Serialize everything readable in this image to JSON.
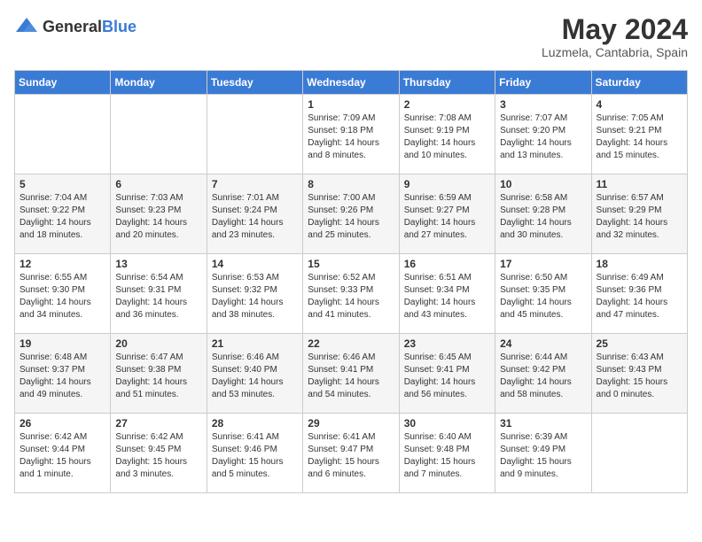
{
  "header": {
    "logo_general": "General",
    "logo_blue": "Blue",
    "month_title": "May 2024",
    "location": "Luzmela, Cantabria, Spain"
  },
  "weekdays": [
    "Sunday",
    "Monday",
    "Tuesday",
    "Wednesday",
    "Thursday",
    "Friday",
    "Saturday"
  ],
  "weeks": [
    [
      {
        "day": "",
        "sunrise": "",
        "sunset": "",
        "daylight": ""
      },
      {
        "day": "",
        "sunrise": "",
        "sunset": "",
        "daylight": ""
      },
      {
        "day": "",
        "sunrise": "",
        "sunset": "",
        "daylight": ""
      },
      {
        "day": "1",
        "sunrise": "Sunrise: 7:09 AM",
        "sunset": "Sunset: 9:18 PM",
        "daylight": "Daylight: 14 hours and 8 minutes."
      },
      {
        "day": "2",
        "sunrise": "Sunrise: 7:08 AM",
        "sunset": "Sunset: 9:19 PM",
        "daylight": "Daylight: 14 hours and 10 minutes."
      },
      {
        "day": "3",
        "sunrise": "Sunrise: 7:07 AM",
        "sunset": "Sunset: 9:20 PM",
        "daylight": "Daylight: 14 hours and 13 minutes."
      },
      {
        "day": "4",
        "sunrise": "Sunrise: 7:05 AM",
        "sunset": "Sunset: 9:21 PM",
        "daylight": "Daylight: 14 hours and 15 minutes."
      }
    ],
    [
      {
        "day": "5",
        "sunrise": "Sunrise: 7:04 AM",
        "sunset": "Sunset: 9:22 PM",
        "daylight": "Daylight: 14 hours and 18 minutes."
      },
      {
        "day": "6",
        "sunrise": "Sunrise: 7:03 AM",
        "sunset": "Sunset: 9:23 PM",
        "daylight": "Daylight: 14 hours and 20 minutes."
      },
      {
        "day": "7",
        "sunrise": "Sunrise: 7:01 AM",
        "sunset": "Sunset: 9:24 PM",
        "daylight": "Daylight: 14 hours and 23 minutes."
      },
      {
        "day": "8",
        "sunrise": "Sunrise: 7:00 AM",
        "sunset": "Sunset: 9:26 PM",
        "daylight": "Daylight: 14 hours and 25 minutes."
      },
      {
        "day": "9",
        "sunrise": "Sunrise: 6:59 AM",
        "sunset": "Sunset: 9:27 PM",
        "daylight": "Daylight: 14 hours and 27 minutes."
      },
      {
        "day": "10",
        "sunrise": "Sunrise: 6:58 AM",
        "sunset": "Sunset: 9:28 PM",
        "daylight": "Daylight: 14 hours and 30 minutes."
      },
      {
        "day": "11",
        "sunrise": "Sunrise: 6:57 AM",
        "sunset": "Sunset: 9:29 PM",
        "daylight": "Daylight: 14 hours and 32 minutes."
      }
    ],
    [
      {
        "day": "12",
        "sunrise": "Sunrise: 6:55 AM",
        "sunset": "Sunset: 9:30 PM",
        "daylight": "Daylight: 14 hours and 34 minutes."
      },
      {
        "day": "13",
        "sunrise": "Sunrise: 6:54 AM",
        "sunset": "Sunset: 9:31 PM",
        "daylight": "Daylight: 14 hours and 36 minutes."
      },
      {
        "day": "14",
        "sunrise": "Sunrise: 6:53 AM",
        "sunset": "Sunset: 9:32 PM",
        "daylight": "Daylight: 14 hours and 38 minutes."
      },
      {
        "day": "15",
        "sunrise": "Sunrise: 6:52 AM",
        "sunset": "Sunset: 9:33 PM",
        "daylight": "Daylight: 14 hours and 41 minutes."
      },
      {
        "day": "16",
        "sunrise": "Sunrise: 6:51 AM",
        "sunset": "Sunset: 9:34 PM",
        "daylight": "Daylight: 14 hours and 43 minutes."
      },
      {
        "day": "17",
        "sunrise": "Sunrise: 6:50 AM",
        "sunset": "Sunset: 9:35 PM",
        "daylight": "Daylight: 14 hours and 45 minutes."
      },
      {
        "day": "18",
        "sunrise": "Sunrise: 6:49 AM",
        "sunset": "Sunset: 9:36 PM",
        "daylight": "Daylight: 14 hours and 47 minutes."
      }
    ],
    [
      {
        "day": "19",
        "sunrise": "Sunrise: 6:48 AM",
        "sunset": "Sunset: 9:37 PM",
        "daylight": "Daylight: 14 hours and 49 minutes."
      },
      {
        "day": "20",
        "sunrise": "Sunrise: 6:47 AM",
        "sunset": "Sunset: 9:38 PM",
        "daylight": "Daylight: 14 hours and 51 minutes."
      },
      {
        "day": "21",
        "sunrise": "Sunrise: 6:46 AM",
        "sunset": "Sunset: 9:40 PM",
        "daylight": "Daylight: 14 hours and 53 minutes."
      },
      {
        "day": "22",
        "sunrise": "Sunrise: 6:46 AM",
        "sunset": "Sunset: 9:41 PM",
        "daylight": "Daylight: 14 hours and 54 minutes."
      },
      {
        "day": "23",
        "sunrise": "Sunrise: 6:45 AM",
        "sunset": "Sunset: 9:41 PM",
        "daylight": "Daylight: 14 hours and 56 minutes."
      },
      {
        "day": "24",
        "sunrise": "Sunrise: 6:44 AM",
        "sunset": "Sunset: 9:42 PM",
        "daylight": "Daylight: 14 hours and 58 minutes."
      },
      {
        "day": "25",
        "sunrise": "Sunrise: 6:43 AM",
        "sunset": "Sunset: 9:43 PM",
        "daylight": "Daylight: 15 hours and 0 minutes."
      }
    ],
    [
      {
        "day": "26",
        "sunrise": "Sunrise: 6:42 AM",
        "sunset": "Sunset: 9:44 PM",
        "daylight": "Daylight: 15 hours and 1 minute."
      },
      {
        "day": "27",
        "sunrise": "Sunrise: 6:42 AM",
        "sunset": "Sunset: 9:45 PM",
        "daylight": "Daylight: 15 hours and 3 minutes."
      },
      {
        "day": "28",
        "sunrise": "Sunrise: 6:41 AM",
        "sunset": "Sunset: 9:46 PM",
        "daylight": "Daylight: 15 hours and 5 minutes."
      },
      {
        "day": "29",
        "sunrise": "Sunrise: 6:41 AM",
        "sunset": "Sunset: 9:47 PM",
        "daylight": "Daylight: 15 hours and 6 minutes."
      },
      {
        "day": "30",
        "sunrise": "Sunrise: 6:40 AM",
        "sunset": "Sunset: 9:48 PM",
        "daylight": "Daylight: 15 hours and 7 minutes."
      },
      {
        "day": "31",
        "sunrise": "Sunrise: 6:39 AM",
        "sunset": "Sunset: 9:49 PM",
        "daylight": "Daylight: 15 hours and 9 minutes."
      },
      {
        "day": "",
        "sunrise": "",
        "sunset": "",
        "daylight": ""
      }
    ]
  ]
}
